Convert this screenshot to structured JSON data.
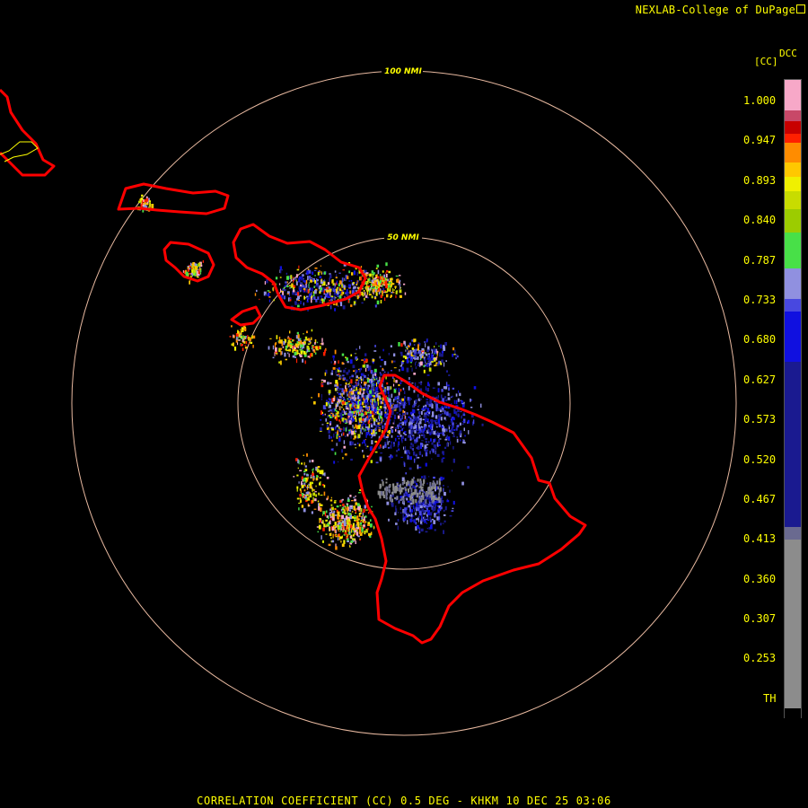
{
  "header": {
    "credit": "NEXLAB-College of DuPage"
  },
  "legend": {
    "unit_label": "[CC]",
    "product_label": "DCC",
    "tick_labels": [
      "1.000",
      "0.947",
      "0.893",
      "0.840",
      "0.787",
      "0.733",
      "0.680",
      "0.627",
      "0.573",
      "0.520",
      "0.467",
      "0.413",
      "0.360",
      "0.307",
      "0.253",
      "TH"
    ]
  },
  "range_rings": [
    {
      "label": "100 NMI"
    },
    {
      "label": "50 NMI"
    }
  ],
  "footer": {
    "title": "CORRELATION COEFFICIENT (CC) 0.5 DEG - KHKM 10 DEC 25 03:06"
  },
  "colors": {
    "background": "#000000",
    "text": "#ffff00",
    "coastline": "#ff0000",
    "county_line": "#ffff00",
    "range_ring": "#e8b9a0"
  }
}
